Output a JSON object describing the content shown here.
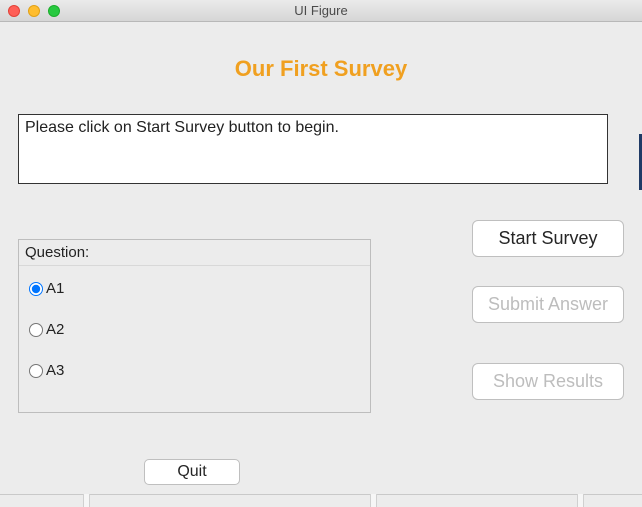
{
  "window": {
    "title": "UI Figure"
  },
  "heading": "Our First Survey",
  "instruction": "Please click on Start Survey button to begin.",
  "buttons": {
    "start": "Start Survey",
    "submit": "Submit Answer",
    "results": "Show Results",
    "quit": "Quit"
  },
  "question": {
    "label": "Question:",
    "options": [
      "A1",
      "A2",
      "A3"
    ],
    "selected_index": 0
  }
}
